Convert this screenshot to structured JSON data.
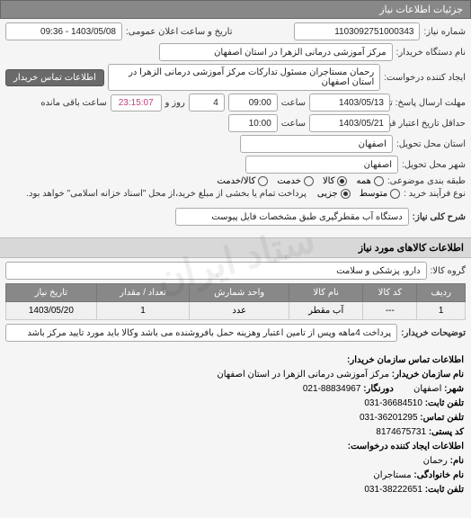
{
  "header": {
    "title": "جزئیات اطلاعات نیاز"
  },
  "fields": {
    "need_number_label": "شماره نیاز:",
    "need_number": "1103092751000343",
    "public_announce_label": "تاریخ و ساعت اعلان عمومی:",
    "public_announce": "1403/05/08 - 09:36",
    "buyer_device_label": "نام دستگاه خریدار:",
    "buyer_device": "مرکز آموزشی درمانی الزهرا در استان اصفهان",
    "requester_label": "ایجاد کننده درخواست:",
    "requester": "رحمان مستاجران مسئول تدارکات مرکز آموزشی درمانی الزهرا در استان اصفهان",
    "contact_btn": "اطلاعات تماس خریدار",
    "deadline_label": "مهلت ارسال پاسخ: تا تاریخ:",
    "deadline_date": "1403/05/13",
    "deadline_time_label": "ساعت",
    "deadline_time": "09:00",
    "remaining": "4",
    "remaining_label_days": "روز و",
    "remaining_time": "23:15:07",
    "remaining_label_suffix": "ساعت باقی مانده",
    "validity_label": "حداقل تاریخ اعتبار قیمت: تا تاریخ:",
    "validity_date": "1403/05/21",
    "validity_time_label": "ساعت",
    "validity_time": "10:00",
    "province_label": "استان محل تحویل:",
    "province": "اصفهان",
    "city_label": "شهر محل تحویل:",
    "city": "اصفهان",
    "budget_class_label": "طبقه بندی موضوعی:",
    "budget_opt_all": "همه",
    "budget_opt_goods": "کالا",
    "budget_opt_service": "خدمت",
    "budget_opt_goods_service": "کالا/خدمت",
    "purchase_type_label": "نوع فرآیند خرید :",
    "purchase_opt_mid": "متوسط",
    "purchase_opt_partial": "جزیی",
    "purchase_note": "پرداخت تمام یا بخشی از مبلغ خرید،از محل \"اسناد خزانه اسلامی\" خواهد بود.",
    "general_desc_label": "شرح کلی نیاز:",
    "general_desc": "دستگاه آب مقطرگیری طبق مشخصات فایل پیوست"
  },
  "goods_section_title": "اطلاعات کالاهای مورد نیاز",
  "goods_group_label": "گروه کالا:",
  "goods_group": "دارو، پزشکی و سلامت",
  "table": {
    "headers": [
      "ردیف",
      "کد کالا",
      "نام کالا",
      "واحد شمارش",
      "تعداد / مقدار",
      "تاریخ نیاز"
    ],
    "rows": [
      {
        "cells": [
          "1",
          "---",
          "آب مقطر",
          "عدد",
          "1",
          "1403/05/20"
        ]
      }
    ]
  },
  "buyer_notes_label": "توضیحات خریدار:",
  "buyer_notes": "پرداخت 4ماهه وپس از تامین اعتبار وهزینه حمل بافروشنده می باشد وکالا باید مورد تایید مرکز باشد",
  "contact": {
    "section1_title": "اطلاعات تماس سازمان خریدار:",
    "org_label": "نام سازمان خریدار:",
    "org": "مرکز آموزشی درمانی الزهرا در استان اصفهان",
    "city_label": "شهر:",
    "city": "اصفهان",
    "phone_label": "تلفن ثابت:",
    "phone": "36684510-031",
    "fax_label": "تلفن تماس:",
    "fax": "36201295-031",
    "post_label": "کد پستی:",
    "post": "8174675731",
    "section2_title": "اطلاعات ایجاد کننده درخواست:",
    "name_label": "نام:",
    "name": "رحمان",
    "lname_label": "نام خانوادگی:",
    "lname": "مستاجران",
    "phone2_label": "تلفن ثابت:",
    "phone2": "38222651-031",
    "dorbari_label": "دورنگار:",
    "dorbari": "88834967-021"
  },
  "watermark": "ستاد ایران"
}
